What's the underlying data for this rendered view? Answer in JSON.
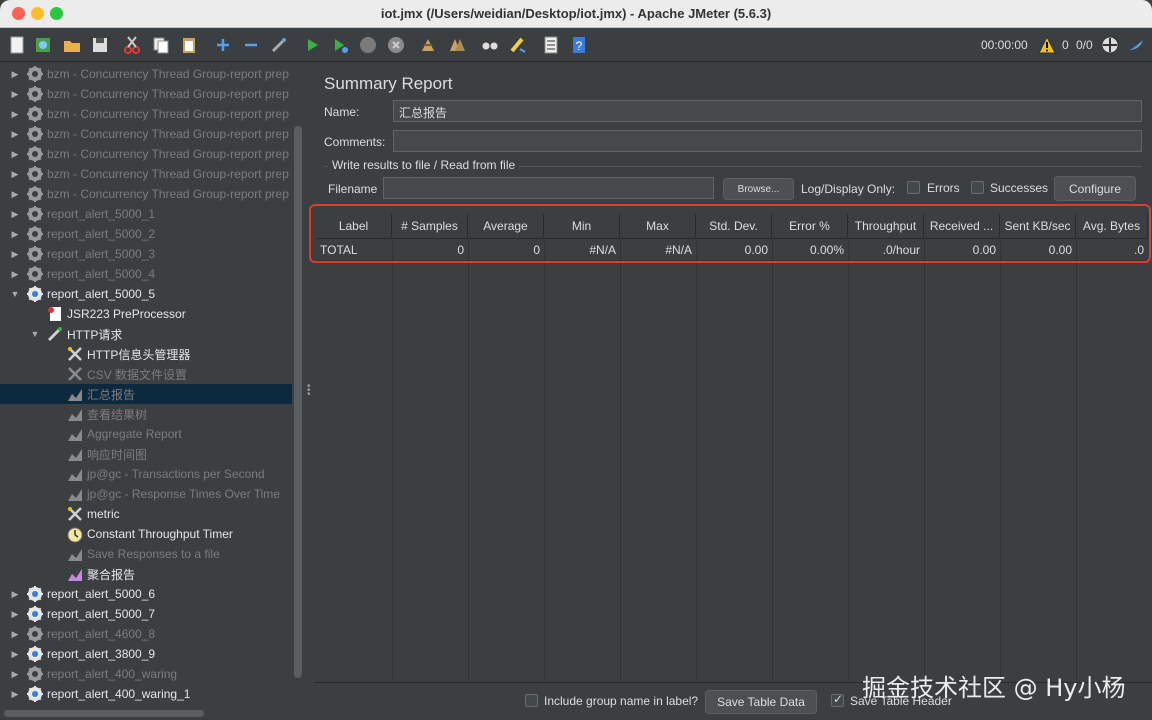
{
  "window": {
    "title": "iot.jmx (/Users/weidian/Desktop/iot.jmx) - Apache JMeter (5.6.3)",
    "traffic_colors": [
      "#fe5f57",
      "#febc2e",
      "#28c840"
    ]
  },
  "toolbar": {
    "timer": "00:00:00",
    "warning_count": "0",
    "threads": "0/0",
    "icons": [
      "new-icon",
      "templates-icon",
      "open-icon",
      "save-icon",
      "cut-icon",
      "copy-icon",
      "paste-icon",
      "expand-icon",
      "collapse-icon",
      "toggle-icon",
      "start-icon",
      "start-no-pauses-icon",
      "stop-icon",
      "shutdown-icon",
      "clear-icon",
      "clear-all-icon",
      "search-icon",
      "reset-search-icon",
      "function-helper-icon",
      "help-icon"
    ]
  },
  "tree": {
    "items": [
      {
        "label": "bzm - Concurrency Thread Group-report prep",
        "depth": 0,
        "arrow": "right",
        "icon": "gear",
        "dim": true
      },
      {
        "label": "bzm - Concurrency Thread Group-report prep",
        "depth": 0,
        "arrow": "right",
        "icon": "gear",
        "dim": true
      },
      {
        "label": "bzm - Concurrency Thread Group-report prep",
        "depth": 0,
        "arrow": "right",
        "icon": "gear",
        "dim": true
      },
      {
        "label": "bzm - Concurrency Thread Group-report prep",
        "depth": 0,
        "arrow": "right",
        "icon": "gear",
        "dim": true
      },
      {
        "label": "bzm - Concurrency Thread Group-report prep",
        "depth": 0,
        "arrow": "right",
        "icon": "gear",
        "dim": true
      },
      {
        "label": "bzm - Concurrency Thread Group-report prep",
        "depth": 0,
        "arrow": "right",
        "icon": "gear",
        "dim": true
      },
      {
        "label": "bzm - Concurrency Thread Group-report prep",
        "depth": 0,
        "arrow": "right",
        "icon": "gear",
        "dim": true
      },
      {
        "label": "report_alert_5000_1",
        "depth": 0,
        "arrow": "right",
        "icon": "gear",
        "dim": true
      },
      {
        "label": "report_alert_5000_2",
        "depth": 0,
        "arrow": "right",
        "icon": "gear",
        "dim": true
      },
      {
        "label": "report_alert_5000_3",
        "depth": 0,
        "arrow": "right",
        "icon": "gear",
        "dim": true
      },
      {
        "label": "report_alert_5000_4",
        "depth": 0,
        "arrow": "right",
        "icon": "gear",
        "dim": true
      },
      {
        "label": "report_alert_5000_5",
        "depth": 0,
        "arrow": "down",
        "icon": "gear",
        "dim": false
      },
      {
        "label": "JSR223 PreProcessor",
        "depth": 1,
        "arrow": "",
        "icon": "script",
        "dim": false
      },
      {
        "label": "HTTP请求",
        "depth": 1,
        "arrow": "down",
        "icon": "pipette",
        "dim": false
      },
      {
        "label": "HTTP信息头管理器",
        "depth": 2,
        "arrow": "",
        "icon": "tools",
        "dim": false
      },
      {
        "label": "CSV 数据文件设置",
        "depth": 2,
        "arrow": "",
        "icon": "tools",
        "dim": true
      },
      {
        "label": "汇总报告",
        "depth": 2,
        "arrow": "",
        "icon": "chart",
        "dim": true,
        "selected": true
      },
      {
        "label": "查看结果树",
        "depth": 2,
        "arrow": "",
        "icon": "chart",
        "dim": true
      },
      {
        "label": "Aggregate Report",
        "depth": 2,
        "arrow": "",
        "icon": "chart",
        "dim": true
      },
      {
        "label": "响应时间图",
        "depth": 2,
        "arrow": "",
        "icon": "chart",
        "dim": true
      },
      {
        "label": "jp@gc - Transactions per Second",
        "depth": 2,
        "arrow": "",
        "icon": "chart",
        "dim": true
      },
      {
        "label": "jp@gc - Response Times Over Time",
        "depth": 2,
        "arrow": "",
        "icon": "chart",
        "dim": true
      },
      {
        "label": "metric",
        "depth": 2,
        "arrow": "",
        "icon": "tools",
        "dim": false
      },
      {
        "label": "Constant Throughput Timer",
        "depth": 2,
        "arrow": "",
        "icon": "timer",
        "dim": false
      },
      {
        "label": "Save Responses to a file",
        "depth": 2,
        "arrow": "",
        "icon": "chart",
        "dim": true
      },
      {
        "label": "聚合报告",
        "depth": 2,
        "arrow": "",
        "icon": "chart-purple",
        "dim": false
      },
      {
        "label": "report_alert_5000_6",
        "depth": 0,
        "arrow": "right",
        "icon": "gear",
        "dim": false
      },
      {
        "label": "report_alert_5000_7",
        "depth": 0,
        "arrow": "right",
        "icon": "gear",
        "dim": false
      },
      {
        "label": "report_alert_4600_8",
        "depth": 0,
        "arrow": "right",
        "icon": "gear",
        "dim": true
      },
      {
        "label": "report_alert_3800_9",
        "depth": 0,
        "arrow": "right",
        "icon": "gear",
        "dim": false
      },
      {
        "label": "report_alert_400_waring",
        "depth": 0,
        "arrow": "right",
        "icon": "gear",
        "dim": true
      },
      {
        "label": "report_alert_400_waring_1",
        "depth": 0,
        "arrow": "right",
        "icon": "gear",
        "dim": false
      }
    ]
  },
  "main": {
    "title": "Summary Report",
    "name_label": "Name:",
    "name_value": "汇总报告",
    "comments_label": "Comments:",
    "comments_value": "",
    "group_title": "Write results to file / Read from file",
    "filename_label": "Filename",
    "filename_value": "",
    "browse_label": "Browse...",
    "log_display_label": "Log/Display Only:",
    "errors_label": "Errors",
    "successes_label": "Successes",
    "configure_label": "Configure"
  },
  "table": {
    "columns": [
      "Label",
      "# Samples",
      "Average",
      "Min",
      "Max",
      "Std. Dev.",
      "Error %",
      "Throughput",
      "Received ...",
      "Sent KB/sec",
      "Avg. Bytes"
    ],
    "rows": [
      [
        "TOTAL",
        "0",
        "0",
        "#N/A",
        "#N/A",
        "0.00",
        "0.00%",
        ".0/hour",
        "0.00",
        "0.00",
        ".0"
      ]
    ],
    "highlight_color": "#e03a2a"
  },
  "footer": {
    "include_group_label": "Include group name in label?",
    "include_group_checked": false,
    "save_table_data_label": "Save Table Data",
    "save_table_header_label": "Save Table Header",
    "save_table_header_checked": true
  },
  "watermark": "掘金技术社区 @ Hy小杨"
}
